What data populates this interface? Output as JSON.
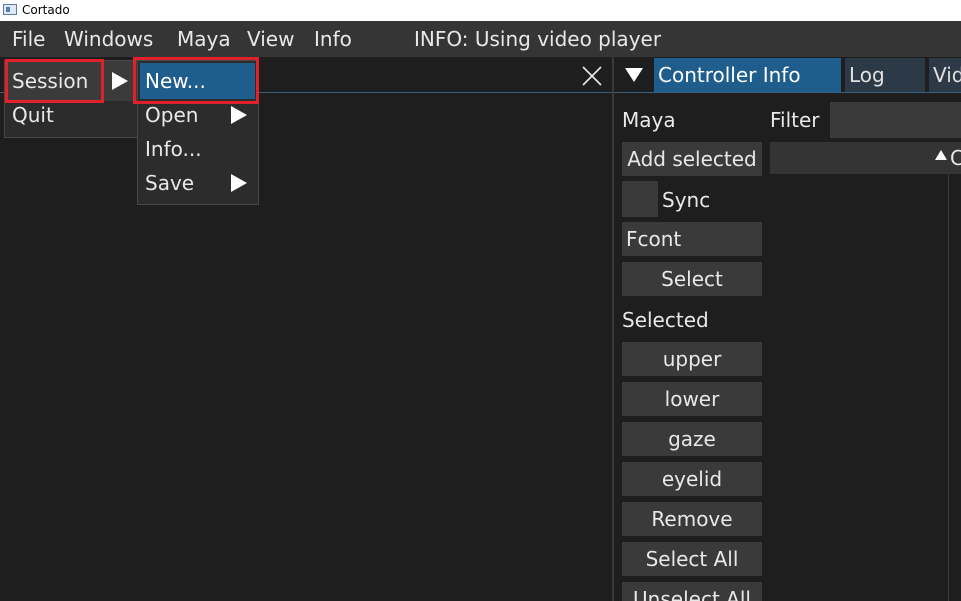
{
  "window": {
    "title": "Cortado"
  },
  "menubar": {
    "items": [
      "File",
      "Windows",
      "Maya",
      "View",
      "Info"
    ],
    "status": "INFO: Using video player"
  },
  "file_menu": {
    "items": [
      "Session",
      "Quit"
    ]
  },
  "session_submenu": {
    "items": [
      "New...",
      "Open",
      "Info...",
      "Save"
    ]
  },
  "right_panel": {
    "tabs": [
      "Controller Info",
      "Log",
      "Vid"
    ],
    "maya_label": "Maya",
    "filter_label": "Filter",
    "filter_value": "",
    "add_selected": "Add selected",
    "sync_label": "Sync",
    "fcont_label": "Fcont",
    "select_label": "Select",
    "selected_label": "Selected",
    "group_buttons": [
      "upper",
      "lower",
      "gaze",
      "eyelid"
    ],
    "remove_label": "Remove",
    "select_all_label": "Select All",
    "unselect_all_label": "Unselect All",
    "list_header_text": "C"
  },
  "colors": {
    "accent": "#1f5d8c",
    "highlight_box": "#e0202a"
  }
}
